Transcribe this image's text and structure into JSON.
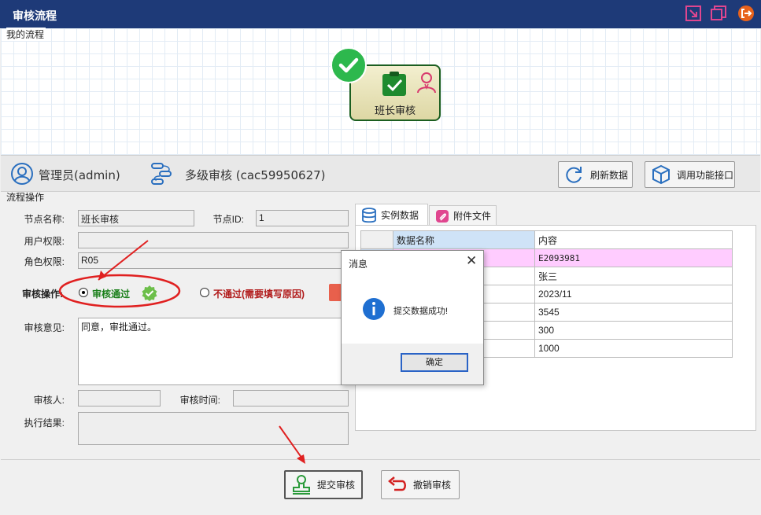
{
  "window": {
    "title": "审核流程"
  },
  "flow": {
    "group_label": "我的流程",
    "node_label": "班长审核"
  },
  "infobar": {
    "user": "管理员(admin)",
    "process": "多级审核 (cac59950627)",
    "refresh_label": "刷新数据",
    "api_label": "调用功能接口"
  },
  "operation": {
    "group_label": "流程操作",
    "node_name_label": "节点名称:",
    "node_name_value": "班长审核",
    "node_id_label": "节点ID:",
    "node_id_value": "1",
    "user_perm_label": "用户权限:",
    "user_perm_value": "",
    "role_perm_label": "角色权限:",
    "role_perm_value": "R05",
    "audit_op_label": "审核操作:",
    "pass_label": "审核通过",
    "reject_label": "不通过(需要填写原因)",
    "opinion_label": "审核意见:",
    "opinion_value": "同意，审批通过。",
    "auditor_label": "审核人:",
    "auditor_value": "",
    "audit_time_label": "审核时间:",
    "audit_time_value": "",
    "result_label": "执行结果:",
    "result_value": ""
  },
  "tabs": [
    {
      "label": "实例数据"
    },
    {
      "label": "附件文件"
    }
  ],
  "grid": {
    "headers": [
      "数据名称",
      "内容"
    ],
    "rows": [
      {
        "content": "E2093981"
      },
      {
        "content": "张三"
      },
      {
        "content": "2023/11"
      },
      {
        "content": "3545"
      },
      {
        "content": "300"
      },
      {
        "content": "1000"
      }
    ]
  },
  "dialog": {
    "title": "消息",
    "message": "提交数据成功!",
    "ok_label": "确定"
  },
  "bottom": {
    "submit_label": "提交审核",
    "cancel_label": "撤销审核"
  },
  "colors": {
    "titlebar": "#1e3a78",
    "accent_pink": "#e0468f",
    "pass_green": "#1a7f1a",
    "reject_red": "#b11a1a",
    "annotation_red": "#e02020",
    "highlight_row": "#ffccff",
    "header_cell": "#cfe3f7"
  }
}
